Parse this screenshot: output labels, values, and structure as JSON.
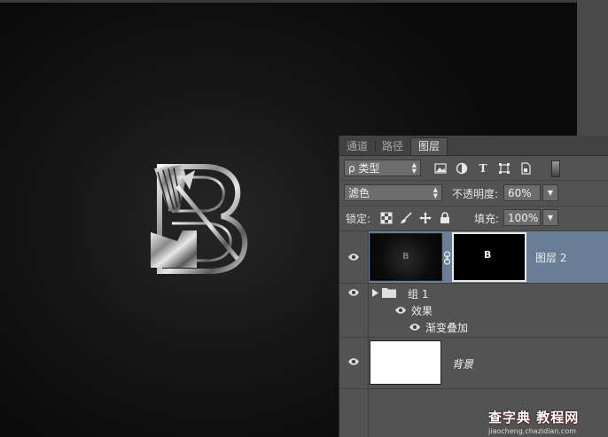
{
  "panel": {
    "tabs": [
      "通道",
      "路径",
      "图层"
    ],
    "active_tab": "图层",
    "filter": {
      "label": "ρ 类型"
    },
    "blend_mode": "滤色",
    "opacity_label": "不透明度:",
    "opacity_value": "60%",
    "lock_label": "锁定:",
    "fill_label": "填充:",
    "fill_value": "100%",
    "layers": [
      {
        "name": "图层 2",
        "selected": true,
        "has_mask": true
      },
      {
        "name": "组 1",
        "type": "group",
        "effects_label": "效果",
        "effect_name": "渐变叠加"
      },
      {
        "name": "背景",
        "italic": true
      }
    ]
  },
  "watermark": {
    "title": "查字典 教程网",
    "url": "jiaocheng.chazidian.com"
  },
  "colors": {
    "panel_bg": "#535353",
    "selected_layer": "#6a7d96",
    "canvas_bg": "#1a1a1a"
  },
  "icons": [
    "eye-icon",
    "chain-link-icon",
    "folder-icon",
    "lock-icon",
    "move-icon",
    "brush-icon",
    "checker-icon",
    "image-filter-icon",
    "circle-filter-icon",
    "text-filter-icon",
    "shape-filter-icon",
    "smart-object-filter-icon"
  ]
}
